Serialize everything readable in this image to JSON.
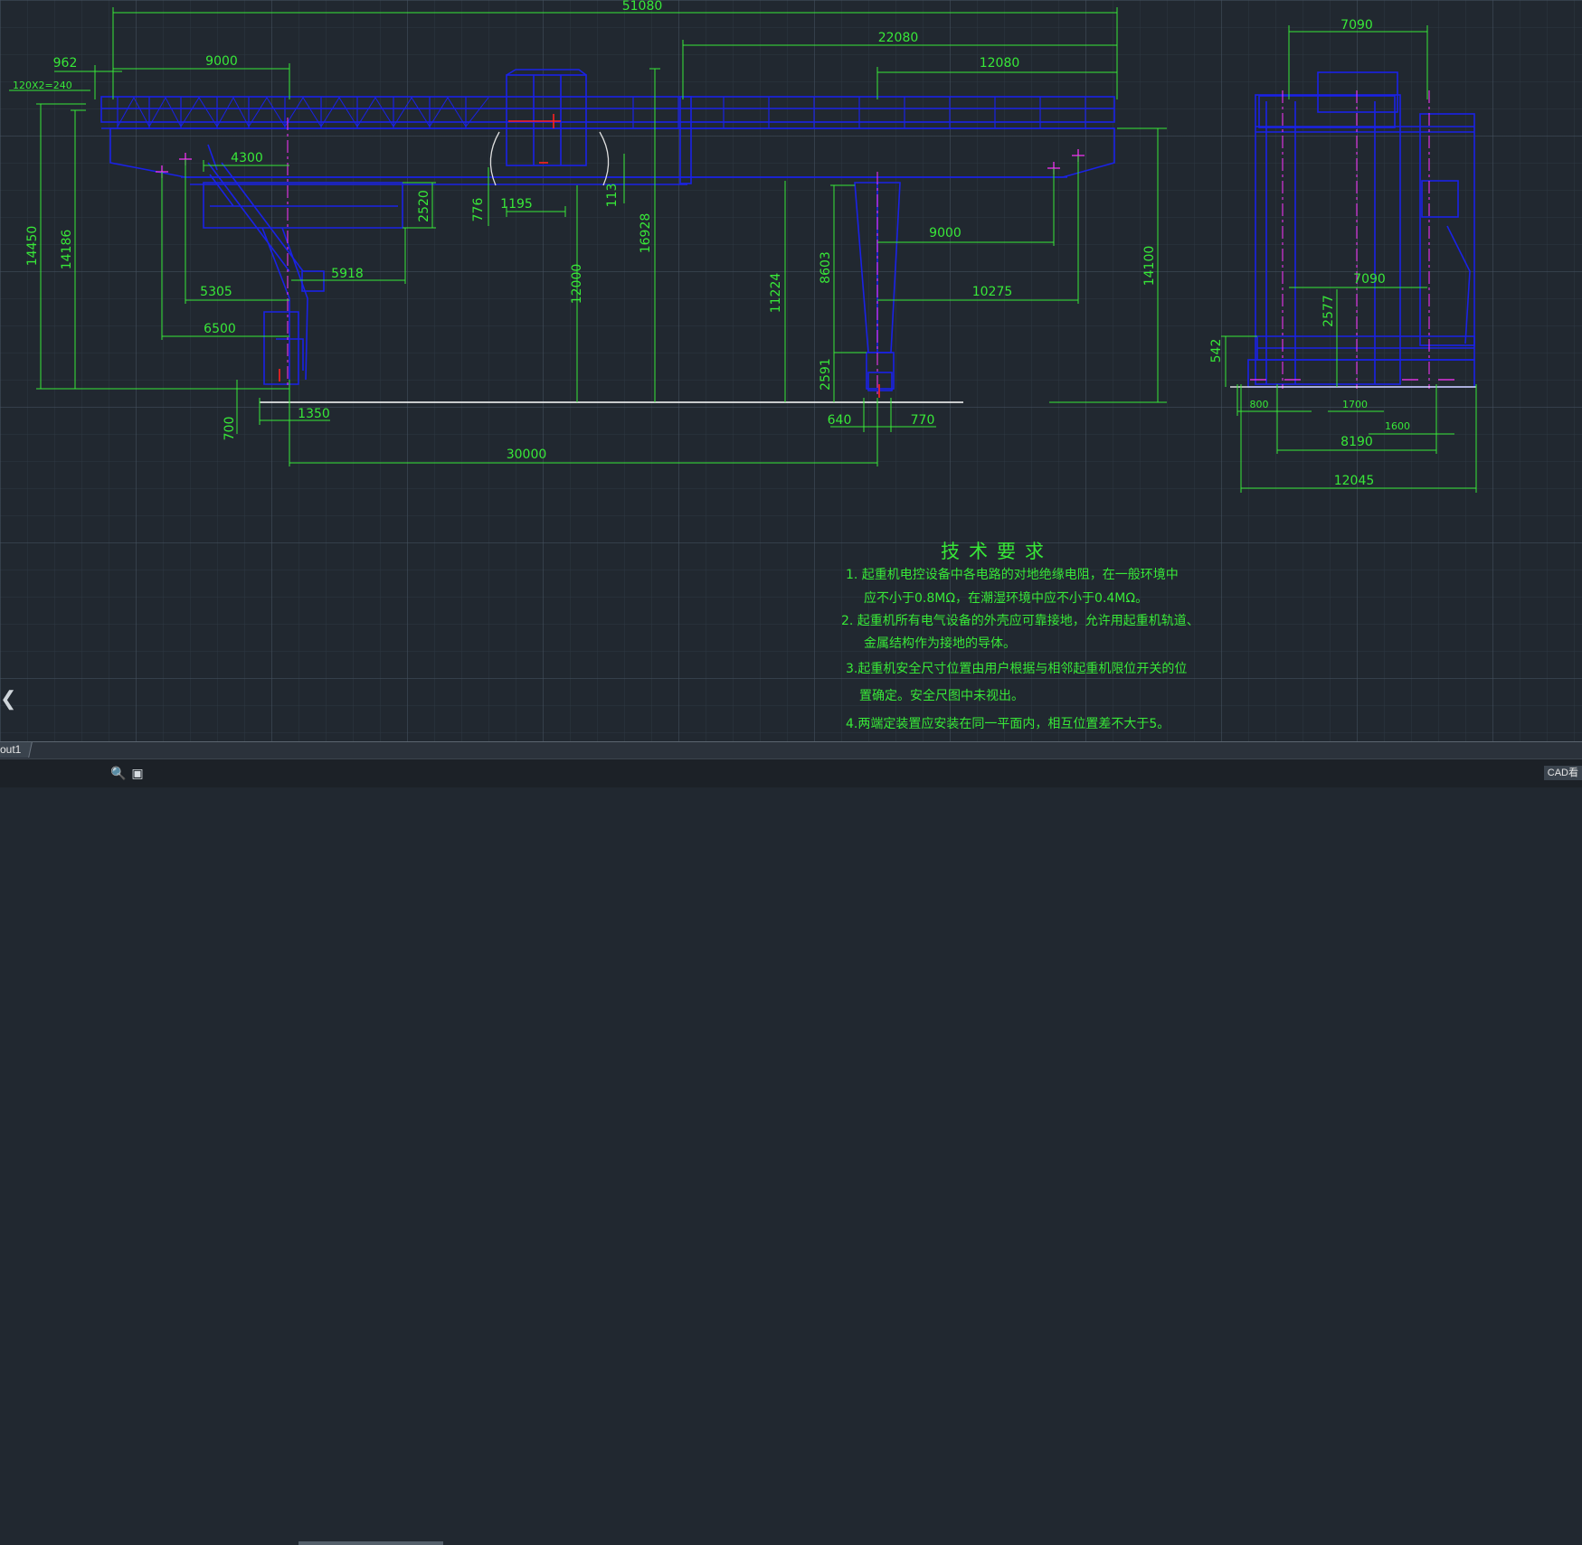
{
  "dimensions": {
    "overall_span": "51080",
    "end_overhang": "962",
    "left_cantilever": "9000",
    "rail_note": "120X2=240",
    "right_rigid_cantilever": "22080",
    "right_cantilever": "12080",
    "leg_offset": "4300",
    "girder_depth": "2520",
    "trolley_hook_offset": "776",
    "trolley_track": "1195",
    "hook_small": "113",
    "max_height": "16928",
    "lift_height": "12000",
    "leg_height": "11224",
    "inner_height": "8603",
    "right_height": "14100",
    "left_height_a": "14450",
    "left_height_b": "14186",
    "right_inner_9000": "9000",
    "right_10275": "10275",
    "left_5305": "5305",
    "left_5918": "5918",
    "left_6500": "6500",
    "base_2591": "2591",
    "bottom_700": "700",
    "bottom_1350": "1350",
    "bottom_640": "640",
    "bottom_770": "770",
    "span_30000": "30000",
    "side_top": "7090",
    "side_inner": "7090",
    "side_2577": "2577",
    "side_542": "542",
    "side_800": "800",
    "side_1700": "1700",
    "side_1600": "1600",
    "side_8190": "8190",
    "side_total": "12045"
  },
  "notes": {
    "title": "技术要求",
    "line1": "1. 起重机电控设备中各电路的对地绝缘电阻，在一般环境中",
    "line1b": "应不小于0.8MΩ，在潮湿环境中应不小于0.4MΩ。",
    "line2": "2. 起重机所有电气设备的外壳应可靠接地，允许用起重机轨道、",
    "line2b": "金属结构作为接地的导体。",
    "line3": "3.起重机安全尺寸位置由用户根据与相邻起重机限位开关的位",
    "line3b": "置确定。安全尺图中未视出。",
    "line4": "4.两端定装置应安装在同一平面内，相互位置差不大于5。"
  },
  "tabs": {
    "layout": "out1"
  },
  "status": {
    "app": "CAD看"
  },
  "icons": {
    "zoom": "zoom-icon",
    "fullscreen": "fullscreen-icon",
    "nav": "chevron-left-icon"
  },
  "colors": {
    "background": "#212830",
    "structure": "#1a22e6",
    "dimension": "#38e838",
    "centerline": "#ff33ff",
    "marker": "#ff2020",
    "ground": "#ffffff"
  }
}
